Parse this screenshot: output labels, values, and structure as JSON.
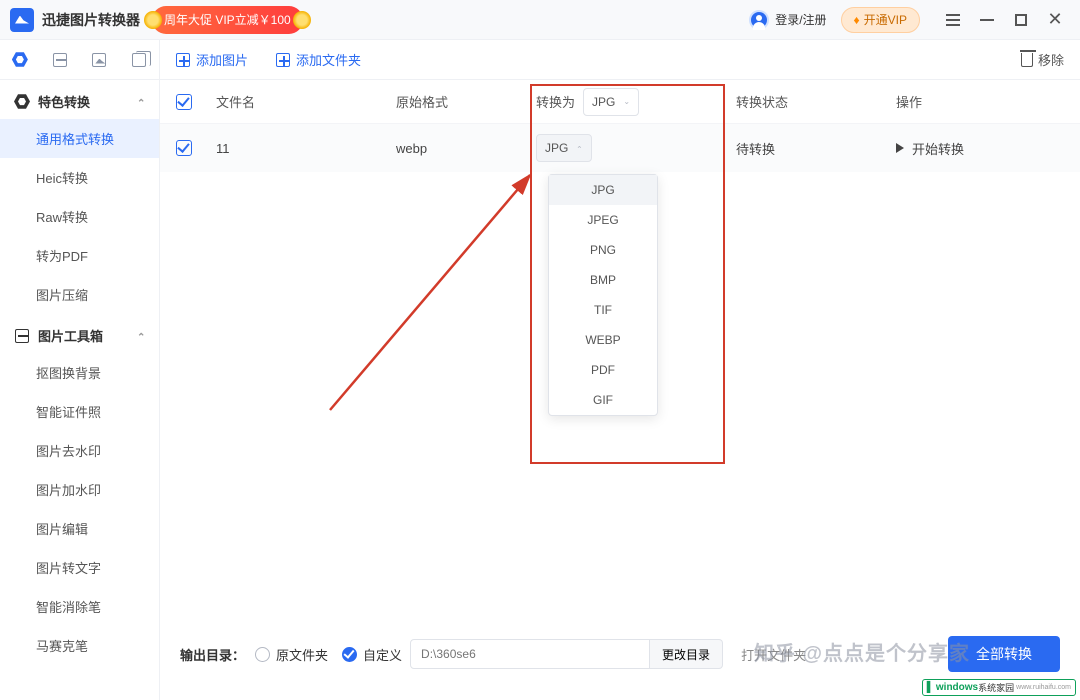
{
  "titlebar": {
    "app_name": "迅捷图片转换器",
    "promo": "周年大促 VIP立减￥100",
    "login": "登录/注册",
    "vip": "开通VIP"
  },
  "sidebar": {
    "group1": {
      "title": "特色转换"
    },
    "nav1": [
      "通用格式转换",
      "Heic转换",
      "Raw转换",
      "转为PDF",
      "图片压缩"
    ],
    "group2": {
      "title": "图片工具箱"
    },
    "nav2": [
      "抠图换背景",
      "智能证件照",
      "图片去水印",
      "图片加水印",
      "图片编辑",
      "图片转文字",
      "智能消除笔",
      "马赛克笔"
    ]
  },
  "toolbar": {
    "add_image": "添加图片",
    "add_folder": "添加文件夹",
    "remove": "移除"
  },
  "columns": {
    "name": "文件名",
    "orig": "原始格式",
    "conv": "转换为",
    "stat": "转换状态",
    "act": "操作"
  },
  "head_select": "JPG",
  "row": {
    "name": "11",
    "orig": "webp",
    "select": "JPG",
    "status": "待转换",
    "action": "开始转换"
  },
  "dropdown": [
    "JPG",
    "JPEG",
    "PNG",
    "BMP",
    "TIF",
    "WEBP",
    "PDF",
    "GIF"
  ],
  "bottom": {
    "output_label": "输出目录：",
    "opt1": "原文件夹",
    "opt2": "自定义",
    "path": "D:\\360se6",
    "change": "更改目录",
    "open": "打开文件夹",
    "convert_all": "全部转换"
  },
  "watermark": "知乎 @点点是个分享家",
  "badge": {
    "brand": "windows",
    "suffix": "系统家园",
    "sub": "www.ruihaifu.com"
  }
}
